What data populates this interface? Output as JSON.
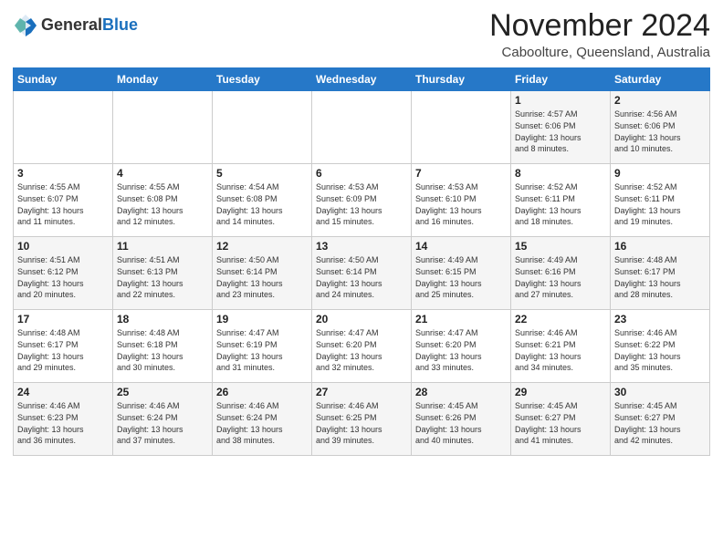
{
  "logo": {
    "general": "General",
    "blue": "Blue"
  },
  "header": {
    "month": "November 2024",
    "location": "Caboolture, Queensland, Australia"
  },
  "weekdays": [
    "Sunday",
    "Monday",
    "Tuesday",
    "Wednesday",
    "Thursday",
    "Friday",
    "Saturday"
  ],
  "weeks": [
    [
      {
        "day": "",
        "info": ""
      },
      {
        "day": "",
        "info": ""
      },
      {
        "day": "",
        "info": ""
      },
      {
        "day": "",
        "info": ""
      },
      {
        "day": "",
        "info": ""
      },
      {
        "day": "1",
        "info": "Sunrise: 4:57 AM\nSunset: 6:06 PM\nDaylight: 13 hours\nand 8 minutes."
      },
      {
        "day": "2",
        "info": "Sunrise: 4:56 AM\nSunset: 6:06 PM\nDaylight: 13 hours\nand 10 minutes."
      }
    ],
    [
      {
        "day": "3",
        "info": "Sunrise: 4:55 AM\nSunset: 6:07 PM\nDaylight: 13 hours\nand 11 minutes."
      },
      {
        "day": "4",
        "info": "Sunrise: 4:55 AM\nSunset: 6:08 PM\nDaylight: 13 hours\nand 12 minutes."
      },
      {
        "day": "5",
        "info": "Sunrise: 4:54 AM\nSunset: 6:08 PM\nDaylight: 13 hours\nand 14 minutes."
      },
      {
        "day": "6",
        "info": "Sunrise: 4:53 AM\nSunset: 6:09 PM\nDaylight: 13 hours\nand 15 minutes."
      },
      {
        "day": "7",
        "info": "Sunrise: 4:53 AM\nSunset: 6:10 PM\nDaylight: 13 hours\nand 16 minutes."
      },
      {
        "day": "8",
        "info": "Sunrise: 4:52 AM\nSunset: 6:11 PM\nDaylight: 13 hours\nand 18 minutes."
      },
      {
        "day": "9",
        "info": "Sunrise: 4:52 AM\nSunset: 6:11 PM\nDaylight: 13 hours\nand 19 minutes."
      }
    ],
    [
      {
        "day": "10",
        "info": "Sunrise: 4:51 AM\nSunset: 6:12 PM\nDaylight: 13 hours\nand 20 minutes."
      },
      {
        "day": "11",
        "info": "Sunrise: 4:51 AM\nSunset: 6:13 PM\nDaylight: 13 hours\nand 22 minutes."
      },
      {
        "day": "12",
        "info": "Sunrise: 4:50 AM\nSunset: 6:14 PM\nDaylight: 13 hours\nand 23 minutes."
      },
      {
        "day": "13",
        "info": "Sunrise: 4:50 AM\nSunset: 6:14 PM\nDaylight: 13 hours\nand 24 minutes."
      },
      {
        "day": "14",
        "info": "Sunrise: 4:49 AM\nSunset: 6:15 PM\nDaylight: 13 hours\nand 25 minutes."
      },
      {
        "day": "15",
        "info": "Sunrise: 4:49 AM\nSunset: 6:16 PM\nDaylight: 13 hours\nand 27 minutes."
      },
      {
        "day": "16",
        "info": "Sunrise: 4:48 AM\nSunset: 6:17 PM\nDaylight: 13 hours\nand 28 minutes."
      }
    ],
    [
      {
        "day": "17",
        "info": "Sunrise: 4:48 AM\nSunset: 6:17 PM\nDaylight: 13 hours\nand 29 minutes."
      },
      {
        "day": "18",
        "info": "Sunrise: 4:48 AM\nSunset: 6:18 PM\nDaylight: 13 hours\nand 30 minutes."
      },
      {
        "day": "19",
        "info": "Sunrise: 4:47 AM\nSunset: 6:19 PM\nDaylight: 13 hours\nand 31 minutes."
      },
      {
        "day": "20",
        "info": "Sunrise: 4:47 AM\nSunset: 6:20 PM\nDaylight: 13 hours\nand 32 minutes."
      },
      {
        "day": "21",
        "info": "Sunrise: 4:47 AM\nSunset: 6:20 PM\nDaylight: 13 hours\nand 33 minutes."
      },
      {
        "day": "22",
        "info": "Sunrise: 4:46 AM\nSunset: 6:21 PM\nDaylight: 13 hours\nand 34 minutes."
      },
      {
        "day": "23",
        "info": "Sunrise: 4:46 AM\nSunset: 6:22 PM\nDaylight: 13 hours\nand 35 minutes."
      }
    ],
    [
      {
        "day": "24",
        "info": "Sunrise: 4:46 AM\nSunset: 6:23 PM\nDaylight: 13 hours\nand 36 minutes."
      },
      {
        "day": "25",
        "info": "Sunrise: 4:46 AM\nSunset: 6:24 PM\nDaylight: 13 hours\nand 37 minutes."
      },
      {
        "day": "26",
        "info": "Sunrise: 4:46 AM\nSunset: 6:24 PM\nDaylight: 13 hours\nand 38 minutes."
      },
      {
        "day": "27",
        "info": "Sunrise: 4:46 AM\nSunset: 6:25 PM\nDaylight: 13 hours\nand 39 minutes."
      },
      {
        "day": "28",
        "info": "Sunrise: 4:45 AM\nSunset: 6:26 PM\nDaylight: 13 hours\nand 40 minutes."
      },
      {
        "day": "29",
        "info": "Sunrise: 4:45 AM\nSunset: 6:27 PM\nDaylight: 13 hours\nand 41 minutes."
      },
      {
        "day": "30",
        "info": "Sunrise: 4:45 AM\nSunset: 6:27 PM\nDaylight: 13 hours\nand 42 minutes."
      }
    ]
  ]
}
